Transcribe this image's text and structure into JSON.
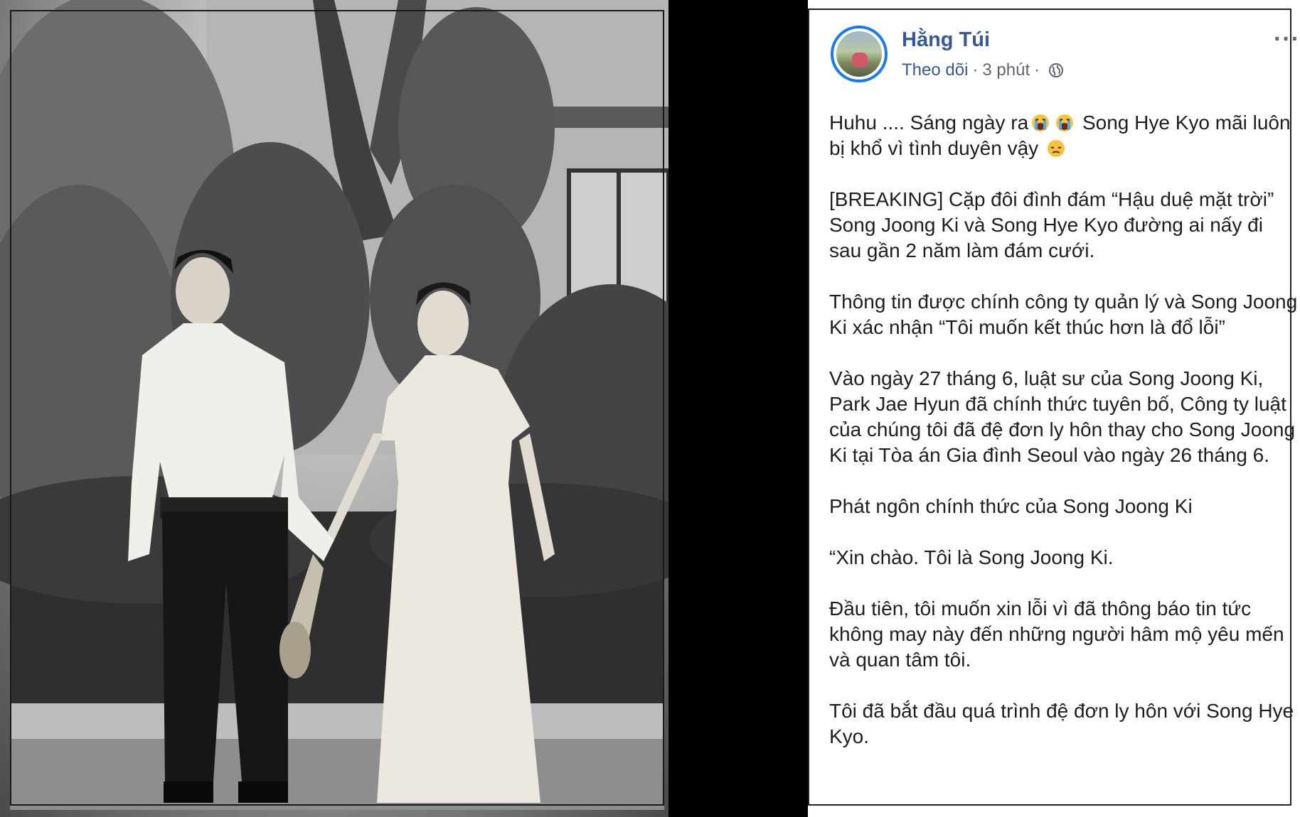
{
  "post": {
    "author": "Hằng Túi",
    "meta": {
      "follow": "Theo dõi",
      "separator": "·",
      "time": "3 phút"
    },
    "more_icon": "more-horizontal-icon",
    "privacy_icon": "globe-icon",
    "paragraphs": {
      "p1_a": "Huhu .... Sáng ngày ra",
      "p1_b": "Song Hye Kyo mãi luôn bị khổ vì tình duyên vậy",
      "p2": "[BREAKING] Cặp đôi đình đám “Hậu duệ mặt trời” Song Joong Ki và Song Hye Kyo đường ai nấy đi sau gần 2 năm làm đám cưới.",
      "p3": "Thông tin được chính công ty quản lý và Song Joong Ki xác nhận “Tôi muốn kết thúc hơn là đổ lỗi”",
      "p4": "Vào ngày 27 tháng 6, luật sư của Song Joong Ki, Park Jae Hyun đã chính thức tuyên bố, Công ty luật của chúng tôi đã đệ đơn ly hôn thay cho Song Joong Ki tại Tòa án Gia đình Seoul vào ngày 26 tháng 6.",
      "p5": "Phát ngôn chính thức của Song Joong Ki",
      "p6": "“Xin chào. Tôi là Song Joong Ki.",
      "p7": "Đầu tiên, tôi muốn xin lỗi vì đã thông báo tin tức không may này đến những người hâm mộ yêu mến và quan tâm tôi.",
      "p8": "Tôi đã bắt đầu quá trình đệ đơn ly hôn với Song Hye Kyo."
    },
    "emojis": [
      "crying-emoji",
      "crying-emoji",
      "disappointed-emoji"
    ]
  },
  "colors": {
    "link": "#385898",
    "meta": "#616770",
    "text": "#1c1e21",
    "avatar_ring": "#1877f2"
  }
}
